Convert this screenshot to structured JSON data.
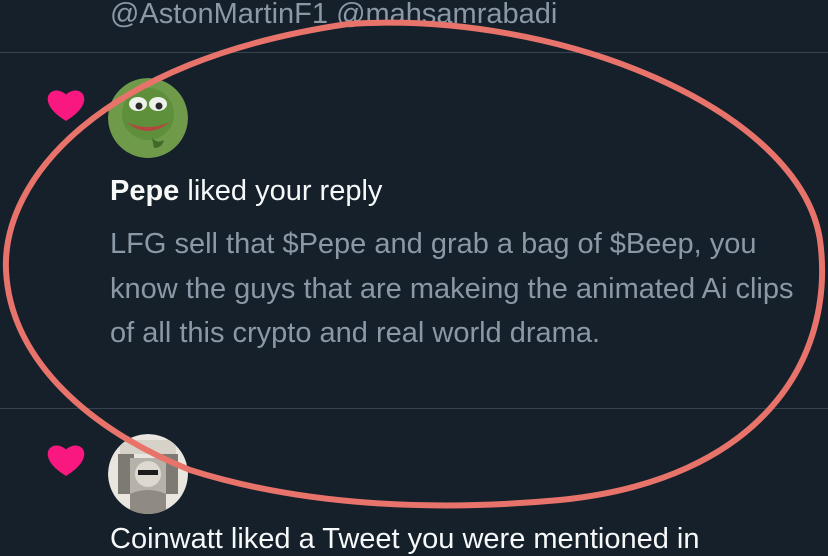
{
  "previous_tweet": {
    "mentions": "@AstonMartinF1 @mahsamrabadi"
  },
  "notifications": [
    {
      "type": "like",
      "icon": "heart-icon",
      "user": "Pepe",
      "action": " liked your reply",
      "content": "LFG sell that $Pepe and grab a bag of $Beep, you know the guys that are makeing the animated Ai clips of all this crypto and real world drama."
    },
    {
      "type": "like",
      "icon": "heart-icon",
      "partial_text": "Coinwatt liked a Tweet you were mentioned in"
    }
  ],
  "colors": {
    "background": "#15202b",
    "like_heart": "#f91880",
    "primary_text": "#f7f9f9",
    "secondary_text": "#8b98a5",
    "divider": "#38444d",
    "annotation_circle": "#e8736a"
  }
}
